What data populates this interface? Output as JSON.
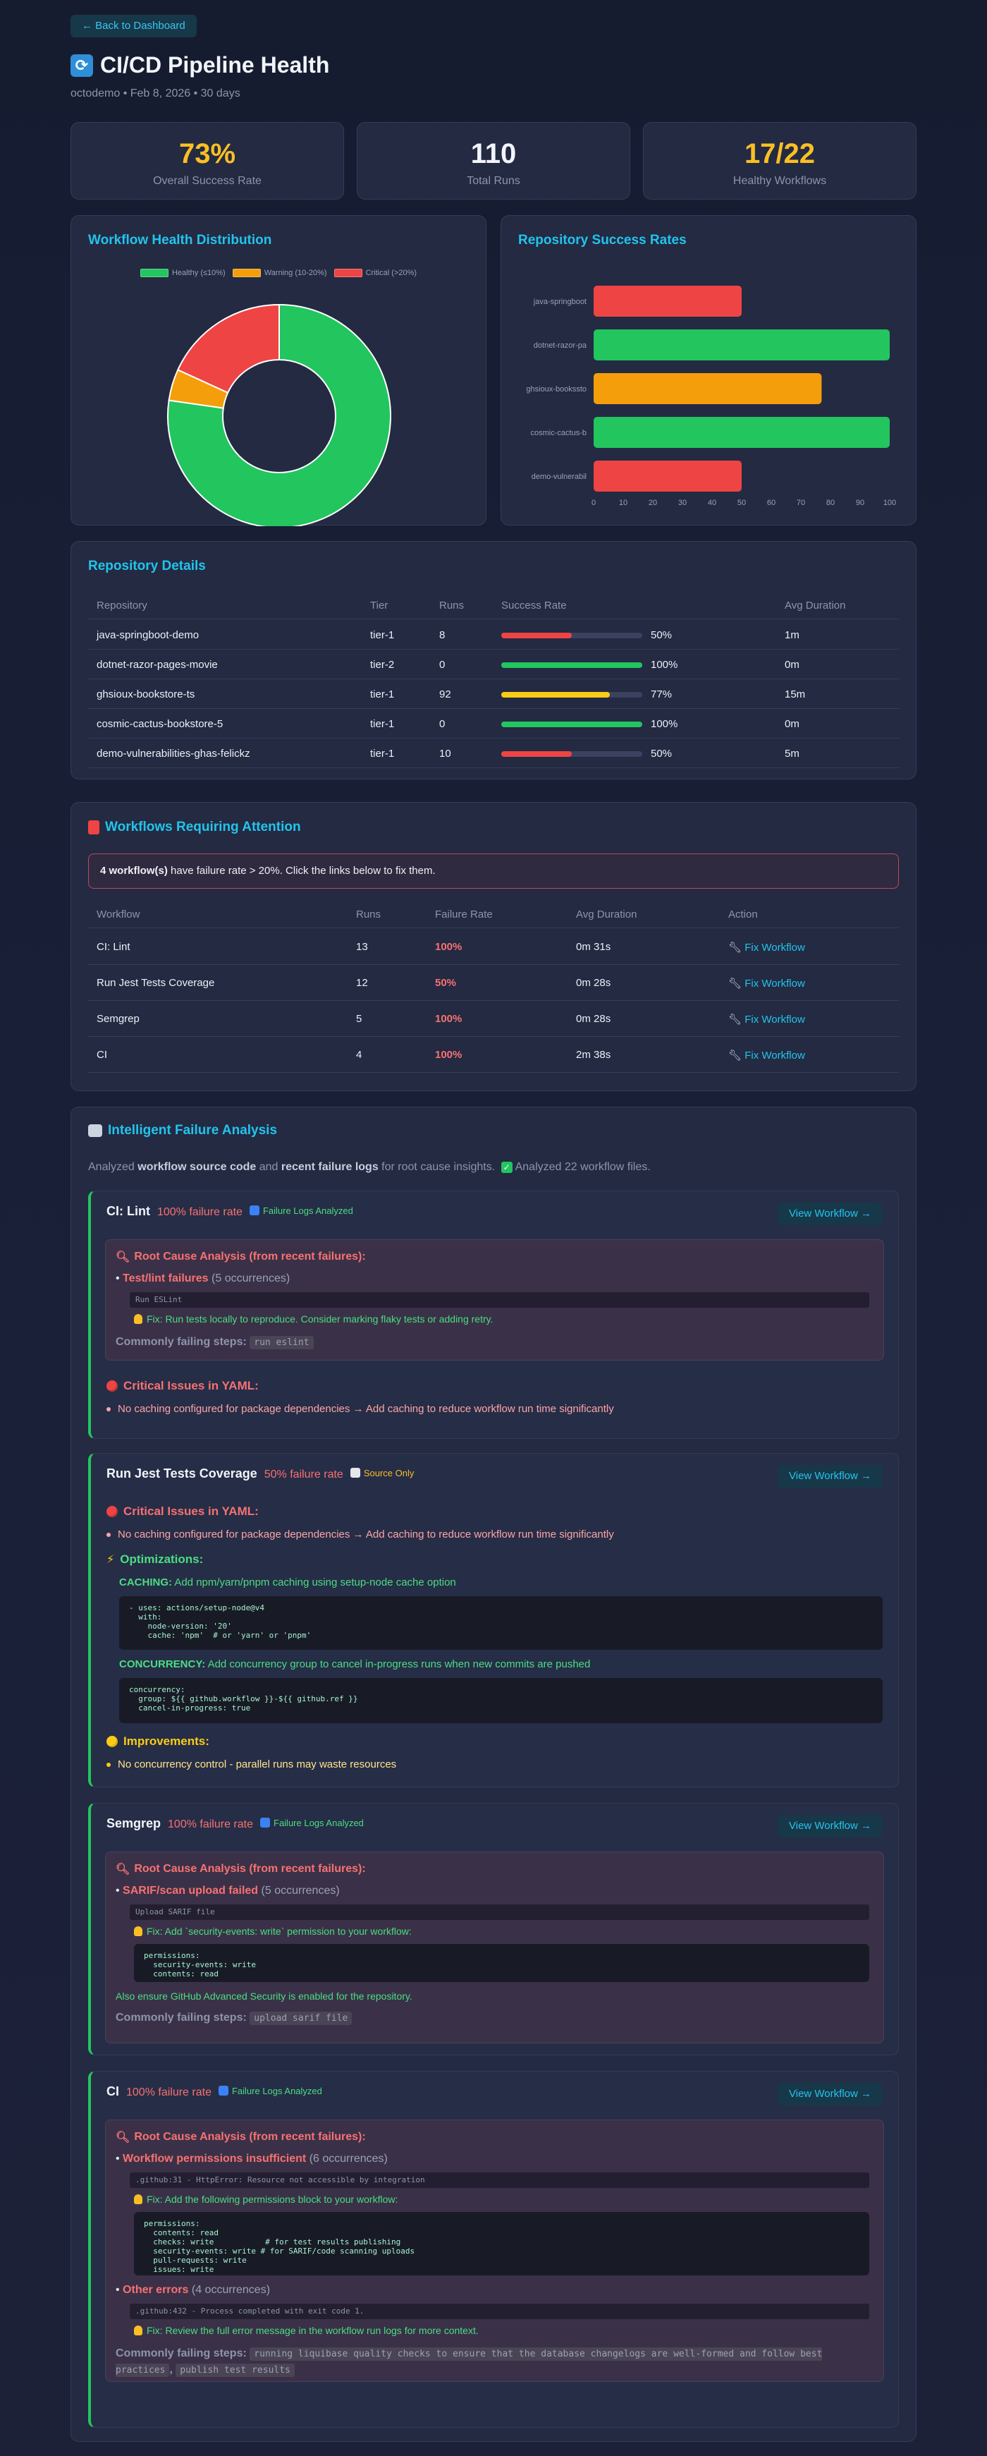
{
  "back_label": "← Back to Dashboard",
  "title": "CI/CD Pipeline Health",
  "subtitle": "octodemo • Feb 8, 2026 • 30 days",
  "stats": [
    {
      "value": "73%",
      "label": "Overall Success Rate",
      "color": "#fbbf24"
    },
    {
      "value": "110",
      "label": "Total Runs",
      "color": "#f2f4fa"
    },
    {
      "value": "17/22",
      "label": "Healthy Workflows",
      "color": "#fbbf24"
    }
  ],
  "chart_data": [
    {
      "type": "pie",
      "title": "Workflow Health Distribution",
      "categories": [
        "Healthy (≤10%)",
        "Warning (10-20%)",
        "Critical (>20%)"
      ],
      "values": [
        17,
        1,
        4
      ],
      "colors": [
        "#22c55e",
        "#f59e0b",
        "#ef4444"
      ],
      "donut": true,
      "legend": "top"
    },
    {
      "type": "bar",
      "orientation": "horizontal",
      "title": "Repository Success Rates",
      "categories": [
        "java-springboot",
        "dotnet-razor-pa",
        "ghsioux-bookssto",
        "cosmic-cactus-b",
        "demo-vulnerabil"
      ],
      "values": [
        50,
        100,
        77,
        100,
        50
      ],
      "colors": [
        "#ef4444",
        "#22c55e",
        "#f59e0b",
        "#22c55e",
        "#ef4444"
      ],
      "xlim": [
        0,
        100
      ],
      "xticks": [
        "0",
        "10",
        "20",
        "30",
        "40",
        "50",
        "60",
        "70",
        "80",
        "90",
        "100"
      ]
    }
  ],
  "repo_details": {
    "title": "Repository Details",
    "headers": [
      "Repository",
      "Tier",
      "Runs",
      "Success Rate",
      "Avg Duration"
    ],
    "rows": [
      {
        "repo": "java-springboot-demo",
        "tier": "tier-1",
        "runs": "8",
        "rate": 50,
        "rate_label": "50%",
        "duration": "1m",
        "color": "#ef4444"
      },
      {
        "repo": "dotnet-razor-pages-movie",
        "tier": "tier-2",
        "runs": "0",
        "rate": 100,
        "rate_label": "100%",
        "duration": "0m",
        "color": "#22c55e"
      },
      {
        "repo": "ghsioux-bookstore-ts",
        "tier": "tier-1",
        "runs": "92",
        "rate": 77,
        "rate_label": "77%",
        "duration": "15m",
        "color": "#facc15"
      },
      {
        "repo": "cosmic-cactus-bookstore-5",
        "tier": "tier-1",
        "runs": "0",
        "rate": 100,
        "rate_label": "100%",
        "duration": "0m",
        "color": "#22c55e"
      },
      {
        "repo": "demo-vulnerabilities-ghas-felickz",
        "tier": "tier-1",
        "runs": "10",
        "rate": 50,
        "rate_label": "50%",
        "duration": "5m",
        "color": "#ef4444"
      }
    ]
  },
  "attention": {
    "title": "Workflows Requiring Attention",
    "alert_bold": "4 workflow(s)",
    "alert_rest": " have failure rate > 20%. Click the links below to fix them.",
    "headers": [
      "Workflow",
      "Runs",
      "Failure Rate",
      "Avg Duration",
      "Action"
    ],
    "fix_label": "Fix Workflow",
    "rows": [
      {
        "workflow": "CI: Lint",
        "runs": "13",
        "rate": "100%",
        "duration": "0m 31s"
      },
      {
        "workflow": "Run Jest Tests Coverage",
        "runs": "12",
        "rate": "50%",
        "duration": "0m 28s"
      },
      {
        "workflow": "Semgrep",
        "runs": "5",
        "rate": "100%",
        "duration": "0m 28s"
      },
      {
        "workflow": "CI",
        "runs": "4",
        "rate": "100%",
        "duration": "2m 38s"
      }
    ]
  },
  "analysis": {
    "title": "Intelligent Failure Analysis",
    "intro_1": "Analyzed ",
    "intro_b1": "workflow source code",
    "intro_2": " and ",
    "intro_b2": "recent failure logs",
    "intro_3": " for root cause insights.",
    "intro_4": "Analyzed 22 workflow files.",
    "view_label": "View Workflow →",
    "rca_title": "Root Cause Analysis (from recent failures):",
    "common_label": "Commonly failing steps:",
    "yaml_title": "Critical Issues in YAML:",
    "opt_title": "Optimizations:",
    "imp_title": "Improvements:",
    "tag_logs": "Failure Logs Analyzed",
    "tag_source": "Source Only",
    "lint": {
      "name": "CI: Lint",
      "rate": "100% failure rate",
      "err": "Test/lint failures",
      "occ": "(5 occurrences)",
      "code": "Run ESLint",
      "fix": "Fix: Run tests locally to reproduce. Consider marking flaky tests or adding retry.",
      "step": "run eslint",
      "yaml_issue": "No caching configured for package dependencies → Add caching to reduce workflow run time significantly"
    },
    "jest": {
      "name": "Run Jest Tests Coverage",
      "rate": "50% failure rate",
      "yaml_issue": "No caching configured for package dependencies → Add caching to reduce workflow run time significantly",
      "caching_key": "CACHING:",
      "caching_text": " Add npm/yarn/pnpm caching using setup-node cache option",
      "caching_code": "- uses: actions/setup-node@v4\n  with:\n    node-version: '20'\n    cache: 'npm'  # or 'yarn' or 'pnpm'",
      "conc_key": "CONCURRENCY:",
      "conc_text": " Add concurrency group to cancel in-progress runs when new commits are pushed",
      "conc_code": "concurrency:\n  group: ${{ github.workflow }}-${{ github.ref }}\n  cancel-in-progress: true",
      "improvement": "No concurrency control - parallel runs may waste resources"
    },
    "semgrep": {
      "name": "Semgrep",
      "rate": "100% failure rate",
      "err": "SARIF/scan upload failed",
      "occ": "(5 occurrences)",
      "code": "Upload SARIF file",
      "fix": "Fix: Add `security-events: write` permission to your workflow:",
      "fix_code": "permissions:\n  security-events: write\n  contents: read",
      "fix_extra": "Also ensure GitHub Advanced Security is enabled for the repository.",
      "step": "upload sarif file"
    },
    "ci": {
      "name": "CI",
      "rate": "100% failure rate",
      "err1": "Workflow permissions insufficient",
      "occ1": "(6 occurrences)",
      "code1": ".github:31 - HttpError: Resource not accessible by integration",
      "fix1": "Fix: Add the following permissions block to your workflow:",
      "fix1_code": "permissions:\n  contents: read\n  checks: write           # for test results publishing\n  security-events: write # for SARIF/code scanning uploads\n  pull-requests: write\n  issues: write",
      "err2": "Other errors",
      "occ2": "(4 occurrences)",
      "code2": ".github:432 - Process completed with exit code 1.",
      "fix2": "Fix: Review the full error message in the workflow run logs for more context.",
      "step1": "running liquibase quality checks to ensure that the database changelogs are well-formed and follow best practices",
      "step2": "publish test results"
    }
  }
}
